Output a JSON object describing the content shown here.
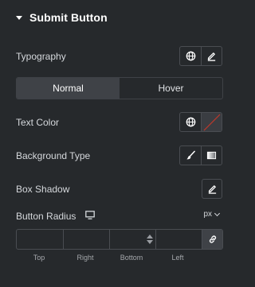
{
  "section": {
    "title": "Submit Button"
  },
  "typography": {
    "label": "Typography"
  },
  "tabs": [
    {
      "label": "Normal",
      "active": true
    },
    {
      "label": "Hover",
      "active": false
    }
  ],
  "text_color": {
    "label": "Text Color"
  },
  "background_type": {
    "label": "Background Type"
  },
  "box_shadow": {
    "label": "Box Shadow"
  },
  "button_radius": {
    "label": "Button Radius",
    "unit": "px",
    "fields": [
      {
        "label": "Top",
        "value": ""
      },
      {
        "label": "Right",
        "value": ""
      },
      {
        "label": "Bottom",
        "value": ""
      },
      {
        "label": "Left",
        "value": ""
      }
    ]
  },
  "colors": {
    "panel_bg": "#26292c",
    "border": "#4a4d52",
    "active_tab": "#3f4247",
    "clear_color_slash": "#c0392b"
  }
}
